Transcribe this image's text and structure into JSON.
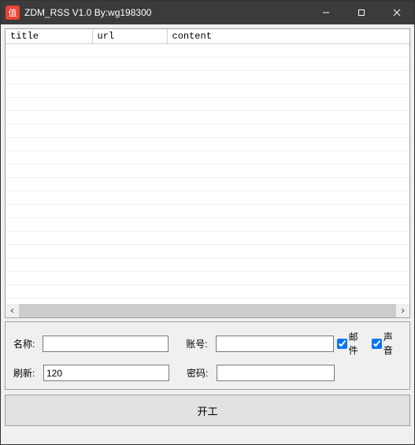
{
  "window": {
    "icon_glyph": "值",
    "title": "ZDM_RSS  V1.0 By:wg198300"
  },
  "table": {
    "columns": [
      "title",
      "url",
      "content"
    ]
  },
  "form": {
    "name_label": "名称:",
    "name_value": "",
    "account_label": "账号:",
    "account_value": "",
    "refresh_label": "刷新:",
    "refresh_value": "120",
    "password_label": "密码:",
    "password_value": "",
    "email_label": "邮件",
    "email_checked": true,
    "sound_label": "声音",
    "sound_checked": true
  },
  "start_button": "开工"
}
